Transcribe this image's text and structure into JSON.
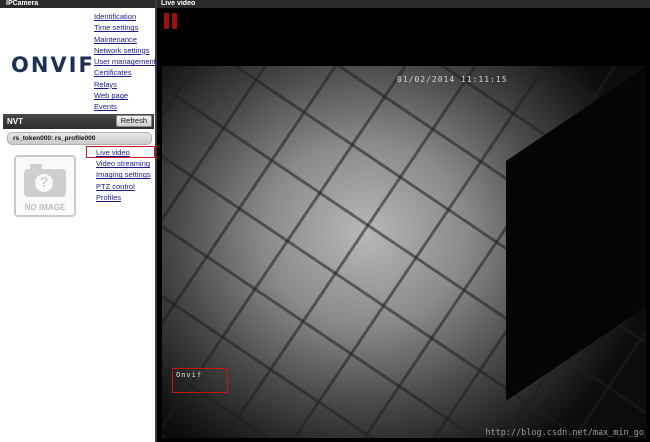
{
  "left_panel": {
    "title": "IPCamera",
    "logo_text": "ONVIF",
    "menu": [
      "Identification",
      "Time settings",
      "Maintenance",
      "Network settings",
      "User management",
      "Certificates",
      "Relays",
      "Web page",
      "Events"
    ],
    "nvt_label": "NVT",
    "refresh_label": "Refresh",
    "device_label": "rs_token000: rs_profile000",
    "no_image_text": "NO IMAGE",
    "submenu": [
      "Live video",
      "Video streaming",
      "Imaging settings",
      "PTZ control",
      "Profiles"
    ]
  },
  "right_panel": {
    "title": "Live video",
    "timestamp": "01/02/2014 11:11:15",
    "osd_text": "Onvif",
    "watermark": "http://blog.csdn.net/max_min_go"
  },
  "colors": {
    "link": "#1a1a8c",
    "highlight_border": "#d01818",
    "pause_icon": "#9d1010"
  }
}
